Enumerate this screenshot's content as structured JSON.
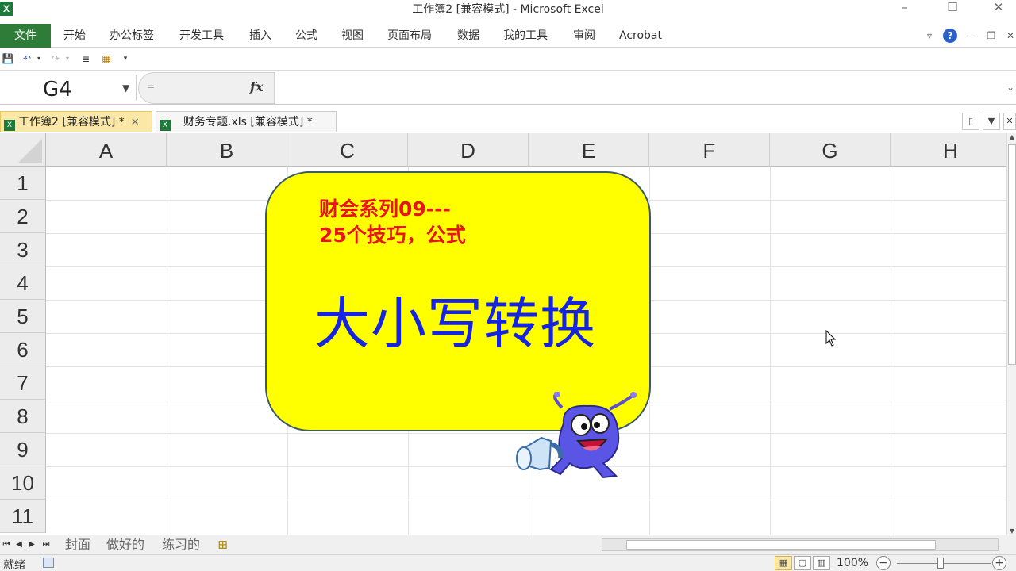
{
  "window": {
    "title": "工作簿2  [兼容模式] - Microsoft Excel",
    "app_icon": "X",
    "controls": [
      "minimize-icon",
      "maximize-icon",
      "close-icon"
    ]
  },
  "ribbon": {
    "tabs": [
      "文件",
      "开始",
      "办公标签",
      "开发工具",
      "插入",
      "公式",
      "视图",
      "页面布局",
      "数据",
      "我的工具",
      "审阅",
      "Acrobat"
    ],
    "help": "?"
  },
  "formula_bar": {
    "name_box": "G4",
    "equals_hint": "=",
    "fx_label": "fx",
    "formula_value": ""
  },
  "doc_tabs": [
    {
      "label": "工作簿2  [兼容模式] *",
      "active": true
    },
    {
      "label": "财务专题.xls  [兼容模式] *",
      "active": false
    }
  ],
  "grid": {
    "columns": [
      "A",
      "B",
      "C",
      "D",
      "E",
      "F",
      "G",
      "H"
    ],
    "rows": [
      "1",
      "2",
      "3",
      "4",
      "5",
      "6",
      "7",
      "8",
      "9",
      "10",
      "11"
    ],
    "active_cell": "G4"
  },
  "callout": {
    "subtitle_line1": "财会系列09---",
    "subtitle_line2": "25个技巧，公式",
    "main_text": "大小写转换",
    "fill_color": "#ffff00",
    "subtitle_color": "#e8131b",
    "main_color": "#1424e0"
  },
  "sheets": [
    "封面",
    "做好的",
    "练习的"
  ],
  "status": {
    "ready": "就绪",
    "zoom": "100%"
  },
  "colors": {
    "file_tab": "#2f7c38",
    "active_doc_tab": "#fbe8a6"
  }
}
